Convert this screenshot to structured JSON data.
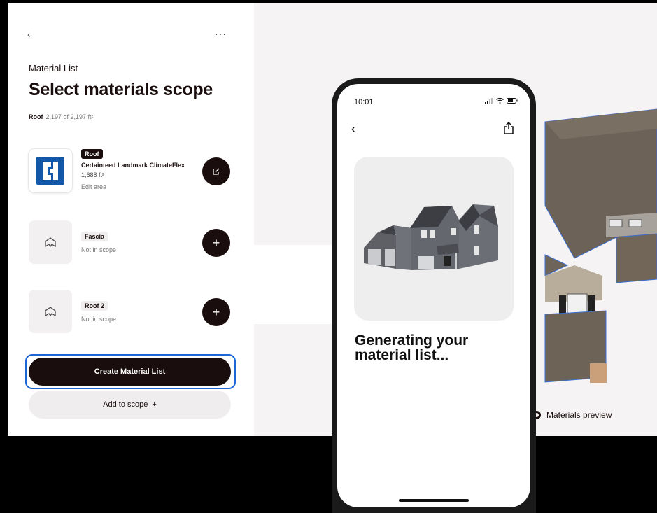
{
  "panel": {
    "back_icon": "chevron-left-icon",
    "more_label": "···",
    "subtitle": "Material List",
    "title": "Select materials scope",
    "scope_name": "Roof",
    "scope_area": "2,197 of 2,197 ft²"
  },
  "materials": [
    {
      "tag": "Roof",
      "name": "Certainteed Landmark ClimateFlex",
      "area": "1,688 ft²",
      "detail": "Edit area",
      "action_icon": "edit-icon"
    },
    {
      "tag": "Fascia",
      "detail": "Not in scope",
      "action_icon": "plus-icon",
      "action_label": "+"
    },
    {
      "tag": "Roof 2",
      "detail": "Not in scope",
      "action_icon": "plus-icon",
      "action_label": "+"
    }
  ],
  "buttons": {
    "create": "Create Material List",
    "add_scope": "Add to scope",
    "add_scope_icon": "+"
  },
  "preview": {
    "toggle_label": "Materials preview"
  },
  "phone": {
    "time": "10:01",
    "heading": "Generating your material list..."
  },
  "colors": {
    "primary_dark": "#1a0d0d",
    "highlight_blue": "#1c66d8",
    "logo_blue": "#1357a8"
  }
}
